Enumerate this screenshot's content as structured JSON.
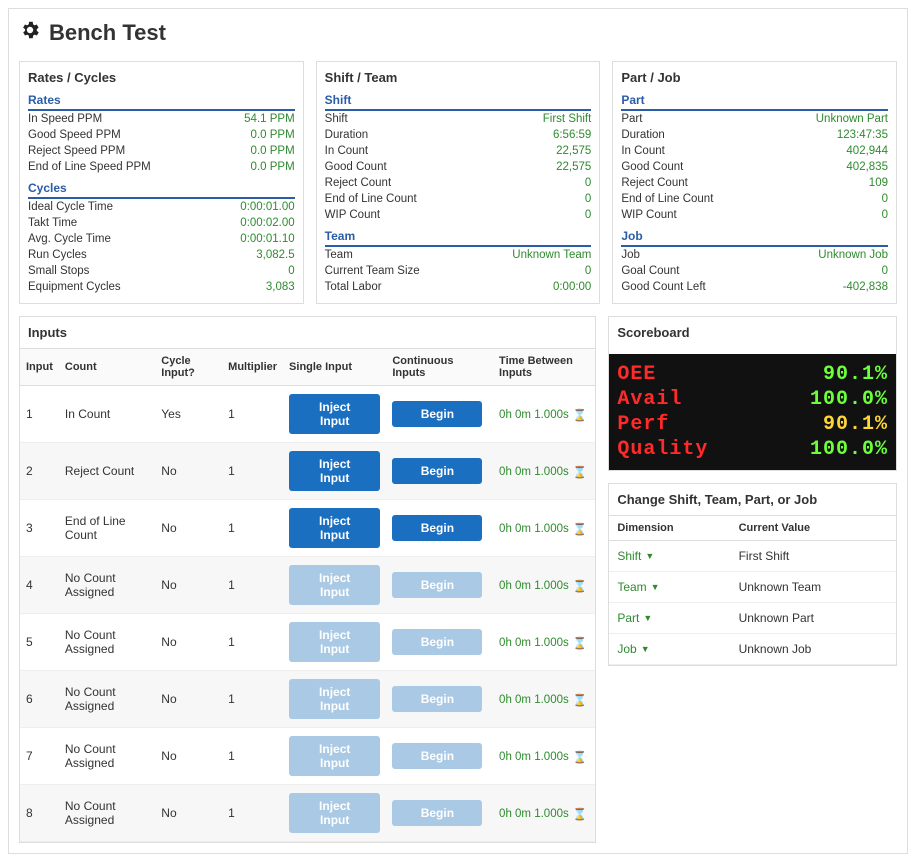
{
  "page": {
    "title": "Bench Test"
  },
  "rates_cycles": {
    "title": "Rates / Cycles",
    "rates_hdr": "Rates",
    "cycles_hdr": "Cycles",
    "rates": {
      "in_speed_ppm": {
        "label": "In Speed PPM",
        "value": "54.1 PPM"
      },
      "good_speed_ppm": {
        "label": "Good Speed PPM",
        "value": "0.0 PPM"
      },
      "reject_speed_ppm": {
        "label": "Reject Speed PPM",
        "value": "0.0 PPM"
      },
      "eol_speed_ppm": {
        "label": "End of Line Speed PPM",
        "value": "0.0 PPM"
      }
    },
    "cycles": {
      "ideal": {
        "label": "Ideal Cycle Time",
        "value": "0:00:01.00"
      },
      "takt": {
        "label": "Takt Time",
        "value": "0:00:02.00"
      },
      "avg": {
        "label": "Avg. Cycle Time",
        "value": "0:00:01.10"
      },
      "run": {
        "label": "Run Cycles",
        "value": "3,082.5"
      },
      "small_stops": {
        "label": "Small Stops",
        "value": "0"
      },
      "equipment": {
        "label": "Equipment Cycles",
        "value": "3,083"
      }
    }
  },
  "shift_team": {
    "title": "Shift / Team",
    "shift_hdr": "Shift",
    "team_hdr": "Team",
    "shift": {
      "shift": {
        "label": "Shift",
        "value": "First Shift"
      },
      "duration": {
        "label": "Duration",
        "value": "6:56:59"
      },
      "in_count": {
        "label": "In Count",
        "value": "22,575"
      },
      "good_count": {
        "label": "Good Count",
        "value": "22,575"
      },
      "reject_count": {
        "label": "Reject Count",
        "value": "0"
      },
      "eol_count": {
        "label": "End of Line Count",
        "value": "0"
      },
      "wip_count": {
        "label": "WIP Count",
        "value": "0"
      }
    },
    "team": {
      "team": {
        "label": "Team",
        "value": "Unknown Team"
      },
      "size": {
        "label": "Current Team Size",
        "value": "0"
      },
      "labor": {
        "label": "Total Labor",
        "value": "0:00:00"
      }
    }
  },
  "part_job": {
    "title": "Part / Job",
    "part_hdr": "Part",
    "job_hdr": "Job",
    "part": {
      "part": {
        "label": "Part",
        "value": "Unknown Part"
      },
      "duration": {
        "label": "Duration",
        "value": "123:47:35"
      },
      "in_count": {
        "label": "In Count",
        "value": "402,944"
      },
      "good_count": {
        "label": "Good Count",
        "value": "402,835"
      },
      "reject_count": {
        "label": "Reject Count",
        "value": "109"
      },
      "eol_count": {
        "label": "End of Line Count",
        "value": "0"
      },
      "wip_count": {
        "label": "WIP Count",
        "value": "0"
      }
    },
    "job": {
      "job": {
        "label": "Job",
        "value": "Unknown Job"
      },
      "goal_count": {
        "label": "Goal Count",
        "value": "0"
      },
      "good_left": {
        "label": "Good Count Left",
        "value": "-402,838"
      }
    }
  },
  "inputs": {
    "title": "Inputs",
    "headers": {
      "input": "Input",
      "count": "Count",
      "cycle": "Cycle Input?",
      "mult": "Multiplier",
      "single": "Single Input",
      "cont": "Continuous Inputs",
      "tbi": "Time Between Inputs"
    },
    "inject_label": "Inject Input",
    "begin_label": "Begin",
    "tbi_value": "0h 0m 1.000s",
    "rows": [
      {
        "num": "1",
        "count": "In Count",
        "cycle": "Yes",
        "mult": "1",
        "enabled": true
      },
      {
        "num": "2",
        "count": "Reject Count",
        "cycle": "No",
        "mult": "1",
        "enabled": true
      },
      {
        "num": "3",
        "count": "End of Line Count",
        "cycle": "No",
        "mult": "1",
        "enabled": true
      },
      {
        "num": "4",
        "count": "No Count Assigned",
        "cycle": "No",
        "mult": "1",
        "enabled": false
      },
      {
        "num": "5",
        "count": "No Count Assigned",
        "cycle": "No",
        "mult": "1",
        "enabled": false
      },
      {
        "num": "6",
        "count": "No Count Assigned",
        "cycle": "No",
        "mult": "1",
        "enabled": false
      },
      {
        "num": "7",
        "count": "No Count Assigned",
        "cycle": "No",
        "mult": "1",
        "enabled": false
      },
      {
        "num": "8",
        "count": "No Count Assigned",
        "cycle": "No",
        "mult": "1",
        "enabled": false
      }
    ]
  },
  "scoreboard": {
    "title": "Scoreboard",
    "rows": [
      {
        "label": "OEE",
        "value": "90.1%",
        "color": "green"
      },
      {
        "label": "Avail",
        "value": "100.0%",
        "color": "green"
      },
      {
        "label": "Perf",
        "value": "90.1%",
        "color": "yellow"
      },
      {
        "label": "Quality",
        "value": "100.0%",
        "color": "green"
      }
    ]
  },
  "change": {
    "title": "Change Shift, Team, Part, or Job",
    "headers": {
      "dim": "Dimension",
      "val": "Current Value"
    },
    "rows": [
      {
        "dim": "Shift",
        "value": "First Shift"
      },
      {
        "dim": "Team",
        "value": "Unknown Team"
      },
      {
        "dim": "Part",
        "value": "Unknown Part"
      },
      {
        "dim": "Job",
        "value": "Unknown Job"
      }
    ]
  }
}
